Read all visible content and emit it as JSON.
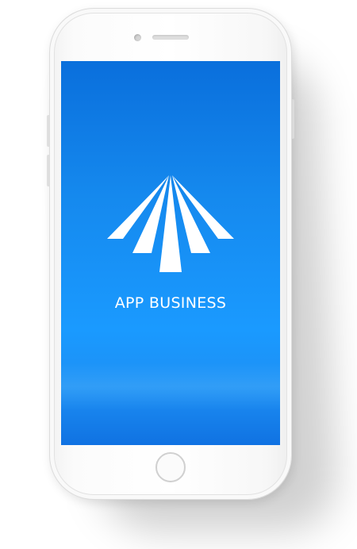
{
  "app": {
    "name": "APP BUSINESS",
    "logo_icon": "paper-plane-rays-logo"
  },
  "device": {
    "type": "phone-mockup",
    "color": "#f6f6f6"
  },
  "screen": {
    "background_top": "#0a6fdc",
    "background_mid": "#1a9aff",
    "text_color": "#ffffff"
  }
}
